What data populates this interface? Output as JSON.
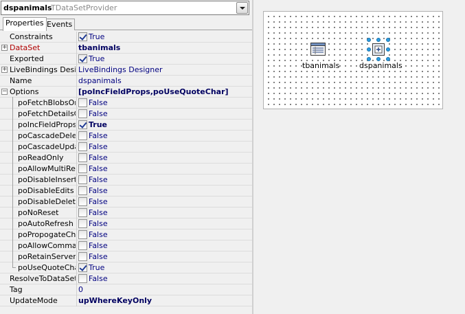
{
  "selector": {
    "component_name": "dspanimals",
    "component_class": "TDataSetProvider"
  },
  "tabs": [
    {
      "label": "Properties",
      "active": true
    },
    {
      "label": "Events",
      "active": false
    }
  ],
  "properties": [
    {
      "name": "Constraints",
      "value": "True",
      "check": true,
      "sub": false,
      "expander": ""
    },
    {
      "name": "DataSet",
      "value": "tbanimals",
      "bold": true,
      "sub": false,
      "expander": "+",
      "red": true
    },
    {
      "name": "Exported",
      "value": "True",
      "check": true,
      "sub": false,
      "expander": ""
    },
    {
      "name": "LiveBindings Designer",
      "value": "LiveBindings Designer",
      "sub": false,
      "expander": "+"
    },
    {
      "name": "Name",
      "value": "dspanimals",
      "sub": false,
      "expander": ""
    },
    {
      "name": "Options",
      "value": "[poIncFieldProps,poUseQuoteChar]",
      "bold": true,
      "sub": false,
      "expander": "−"
    },
    {
      "name": "poFetchBlobsOnDemand",
      "value": "False",
      "check": false,
      "sub": true
    },
    {
      "name": "poFetchDetailsOnDemand",
      "value": "False",
      "check": false,
      "sub": true
    },
    {
      "name": "poIncFieldProps",
      "value": "True",
      "check": true,
      "bold": true,
      "sub": true
    },
    {
      "name": "poCascadeDeletes",
      "value": "False",
      "check": false,
      "sub": true
    },
    {
      "name": "poCascadeUpdates",
      "value": "False",
      "check": false,
      "sub": true
    },
    {
      "name": "poReadOnly",
      "value": "False",
      "check": false,
      "sub": true
    },
    {
      "name": "poAllowMultiRecordUpdates",
      "value": "False",
      "check": false,
      "sub": true
    },
    {
      "name": "poDisableInserts",
      "value": "False",
      "check": false,
      "sub": true
    },
    {
      "name": "poDisableEdits",
      "value": "False",
      "check": false,
      "sub": true
    },
    {
      "name": "poDisableDeletes",
      "value": "False",
      "check": false,
      "sub": true
    },
    {
      "name": "poNoReset",
      "value": "False",
      "check": false,
      "sub": true
    },
    {
      "name": "poAutoRefresh",
      "value": "False",
      "check": false,
      "sub": true
    },
    {
      "name": "poPropogateChanges",
      "value": "False",
      "check": false,
      "sub": true
    },
    {
      "name": "poAllowCommandText",
      "value": "False",
      "check": false,
      "sub": true
    },
    {
      "name": "poRetainServerOrder",
      "value": "False",
      "check": false,
      "sub": true
    },
    {
      "name": "poUseQuoteChar",
      "value": "True",
      "check": true,
      "sub": true
    },
    {
      "name": "ResolveToDataSet",
      "value": "False",
      "check": false,
      "sub": false,
      "expander": ""
    },
    {
      "name": "Tag",
      "value": "0",
      "sub": false,
      "expander": ""
    },
    {
      "name": "UpdateMode",
      "value": "upWhereKeyOnly",
      "bold": true,
      "sub": false,
      "expander": ""
    }
  ],
  "designer": {
    "components": [
      {
        "label": "tbanimals",
        "icon": "table-icon"
      },
      {
        "label": "dspanimals",
        "icon": "provider-icon",
        "selected": true
      }
    ]
  }
}
